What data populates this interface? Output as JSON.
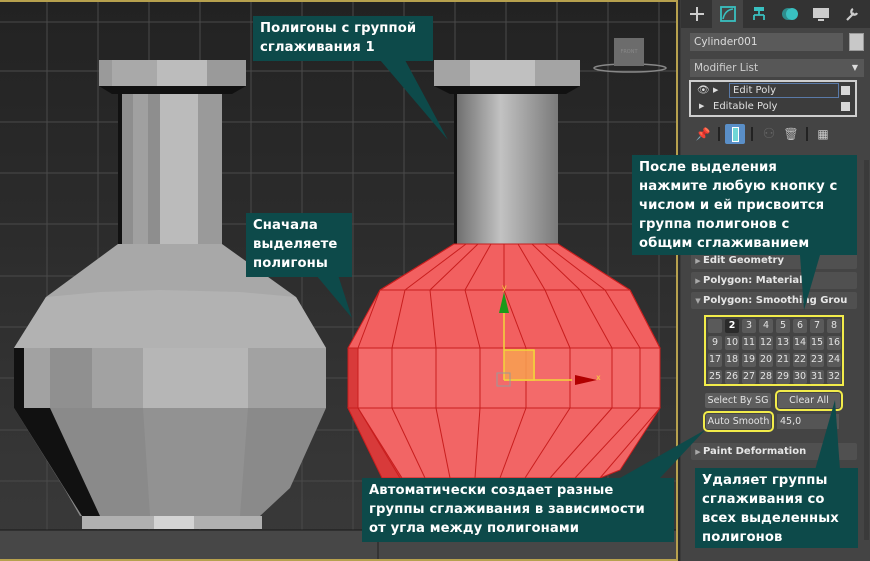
{
  "viewport": {
    "viewcube_label": "FRONT",
    "gizmo": {
      "x_axis": "x",
      "y_axis": "y"
    }
  },
  "panel": {
    "tabs": [
      {
        "icon": "create-icon",
        "active": false
      },
      {
        "icon": "modify-icon",
        "active": true
      },
      {
        "icon": "hierarchy-icon",
        "active": false
      },
      {
        "icon": "motion-icon",
        "active": false
      },
      {
        "icon": "display-icon",
        "active": false
      },
      {
        "icon": "utilities-icon",
        "active": false
      }
    ],
    "object_name": "Cylinder001",
    "modifier_list": "Modifier List",
    "stack": [
      {
        "label": "Edit Poly",
        "selected": true
      },
      {
        "label": "Editable Poly",
        "selected": false
      }
    ],
    "rollouts": {
      "edit_geometry": "Edit Geometry",
      "polygon_material": "Polygon: Material I",
      "polygon_smoothing": "Polygon: Smoothing Grou",
      "paint_deformation": "Paint Deformation"
    },
    "smoothing_groups": [
      "",
      "2",
      "3",
      "4",
      "5",
      "6",
      "7",
      "8",
      "9",
      "10",
      "11",
      "12",
      "13",
      "14",
      "15",
      "16",
      "17",
      "18",
      "19",
      "20",
      "21",
      "22",
      "23",
      "24",
      "25",
      "26",
      "27",
      "28",
      "29",
      "30",
      "31",
      "32"
    ],
    "select_by_sg": "Select By SG",
    "clear_all": "Clear All",
    "auto_smooth": "Auto Smooth",
    "auto_smooth_threshold": "45,0"
  },
  "callouts": {
    "top": [
      "Полигоны с группой",
      "сглаживания 1"
    ],
    "left": [
      "Сначала",
      "выделяете",
      "полигоны"
    ],
    "right_top": [
      "После выделения",
      "нажмите любую кнопку с",
      "числом и ей присвоится",
      "группа полигонов с",
      "общим сглаживанием"
    ],
    "bottom": [
      "Автоматически создает разные",
      "группы сглаживания в зависимости",
      "от угла между полигонами"
    ],
    "bottom_right": [
      "Удаляет группы",
      "сглаживания со",
      "всех выделенных",
      "полигонов"
    ]
  },
  "colors": {
    "callout_bg": "#0d4a4a",
    "highlight": "#f2ec4a",
    "selection_red": "#f26060",
    "viewport_border": "#b7a14e"
  }
}
